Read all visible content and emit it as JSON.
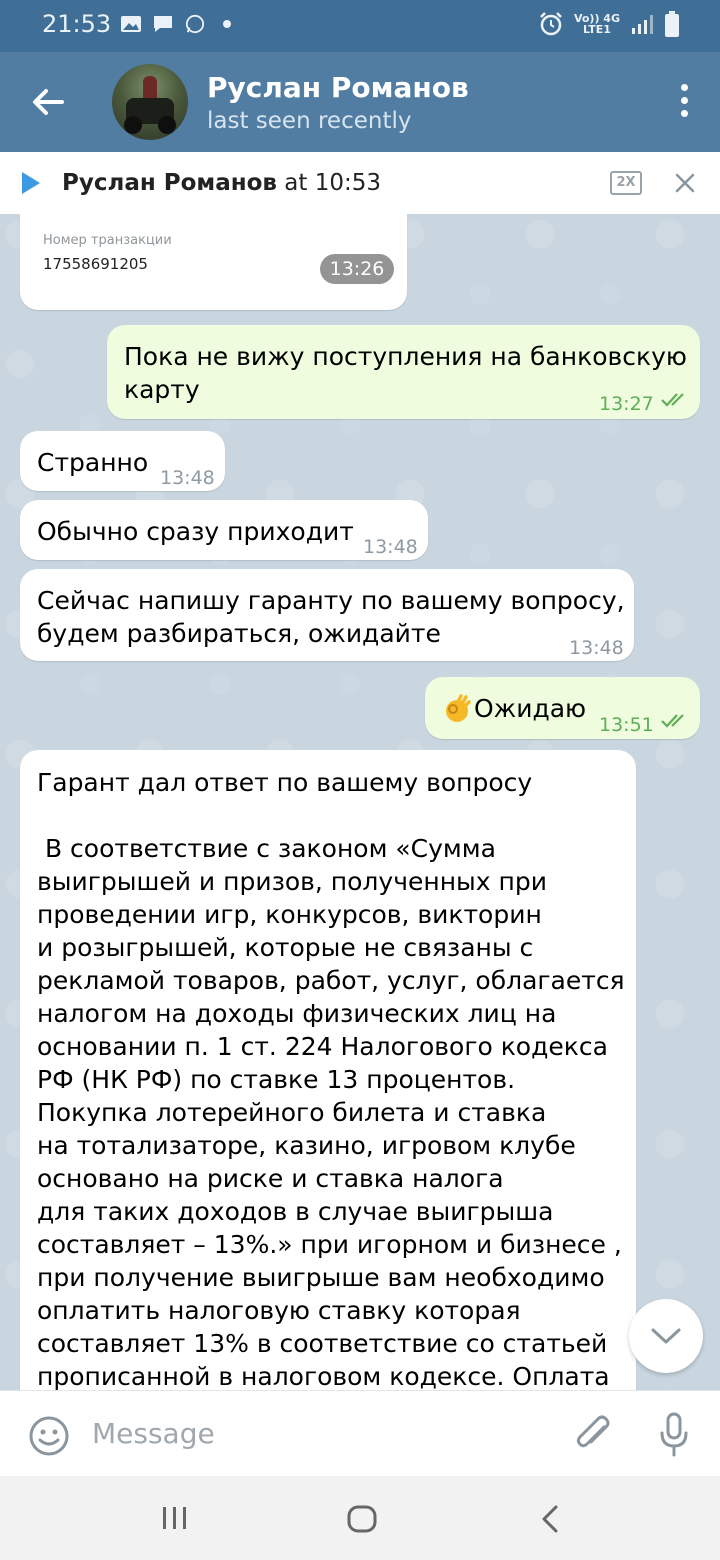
{
  "status_bar": {
    "time": "21:53",
    "network_top": "Vo)) 4G",
    "network_bottom": "LTE1"
  },
  "header": {
    "name": "Руслан Романов",
    "status": "last seen recently"
  },
  "player": {
    "name": "Руслан Романов",
    "at_time": "at 10:53",
    "speed": "2X"
  },
  "messages": {
    "receipt": {
      "label": "Номер транзакции",
      "number": "17558691205",
      "time": "13:26"
    },
    "m1": {
      "text_line1": "Пока не вижу поступления на банковскую",
      "text_line2": "карту",
      "time": "13:27"
    },
    "m2": {
      "text": "Странно",
      "time": "13:48"
    },
    "m3": {
      "text": "Обычно сразу приходит",
      "time": "13:48"
    },
    "m4": {
      "text_line1": "Сейчас напишу гаранту по вашему вопросу,",
      "text_line2": "будем разбираться, ожидайте",
      "time": "13:48"
    },
    "m5": {
      "text": "Ожидаю",
      "time": "13:51"
    },
    "m6": {
      "lines": [
        "Гарант дал ответ по вашему вопросу",
        "",
        " В соответствие с законом «Сумма",
        "выигрышей и призов, полученных при",
        "проведении игр, конкурсов, викторин",
        "и розыгрышей, которые не связаны с",
        "рекламой товаров, работ, услуг, облагается",
        "налогом на доходы физических лиц на",
        "основании п. 1 ст. 224 Налогового кодекса",
        "РФ (НК РФ) по ставке 13 процентов.",
        "Покупка лотерейного билета и ставка",
        "на тотализаторе, казино, игровом клубе",
        "основано на риске и ставка налога",
        "для таких доходов в случае выигрыша",
        "составляет – 13%.» при игорном и бизнесе ,",
        "при получение выигрыше вам необходимо",
        "оплатить налоговую ставку которая",
        "составляет 13% в соответствие со статьей",
        "прописанной в налоговом кодексе. Оплата"
      ]
    }
  },
  "input": {
    "placeholder": "Message"
  }
}
